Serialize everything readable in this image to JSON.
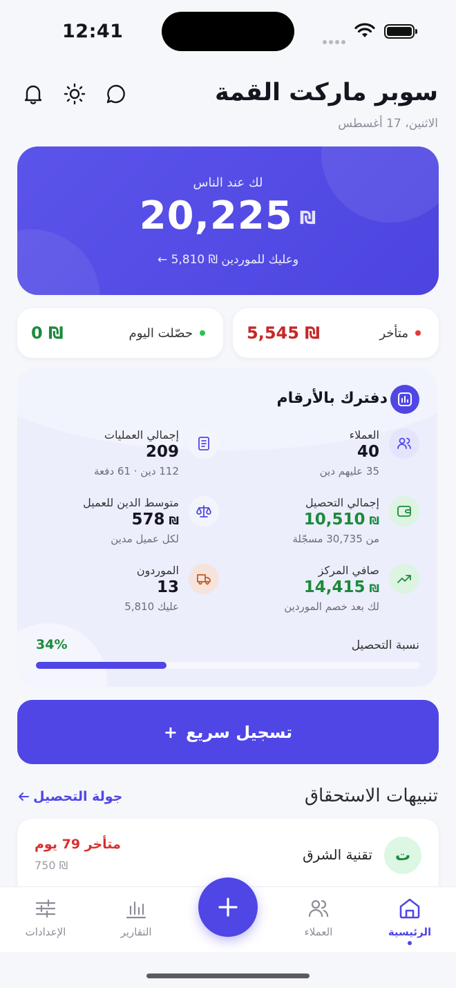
{
  "status": {
    "time": "12:41"
  },
  "header": {
    "title": "سوبر ماركت القمة",
    "date": "الاثنين، 17 أغسطس"
  },
  "hero": {
    "label": "لك عند الناس",
    "amount": "20,225",
    "currency": "₪",
    "suppliers_text": "وعليك للموردين ₪ 5,810 ←"
  },
  "stats": {
    "collected_today_label": "حصّلت اليوم",
    "collected_today_value": "0 ₪",
    "overdue_label": "متأخر",
    "overdue_value": "5,545 ₪"
  },
  "numbers": {
    "title": "دفترك بالأرقام",
    "metrics": [
      {
        "label": "العملاء",
        "value": "40",
        "sub": "35 عليهم دين"
      },
      {
        "label": "إجمالي العمليات",
        "value": "209",
        "sub": "112 دين · 61 دفعة"
      },
      {
        "label": "إجمالي التحصيل",
        "value": "10,510",
        "currency": "₪",
        "sub": "من 30,735 مسجّلة"
      },
      {
        "label": "متوسط الدين للعميل",
        "value": "578",
        "currency": "₪",
        "sub": "لكل عميل مدين"
      },
      {
        "label": "صافي المركز",
        "value": "14,415",
        "currency": "₪",
        "sub": "لك بعد خصم الموردين"
      },
      {
        "label": "الموردون",
        "value": "13",
        "sub": "عليك 5,810"
      }
    ],
    "rate_label": "نسبة التحصيل",
    "rate_value": "34%",
    "rate_fraction": 0.34
  },
  "quick_button": {
    "label": "تسجيل سريع",
    "icon": "+"
  },
  "alerts": {
    "title": "تنبيهات الاستحقاق",
    "link": "جولة التحصيل",
    "items": [
      {
        "initial": "ت",
        "name": "تقنية الشرق",
        "status": "متأخر 79 يوم",
        "amount": "750 ₪"
      }
    ]
  },
  "tabbar": {
    "home": "الرئيسية",
    "customers": "العملاء",
    "reports": "التقارير",
    "settings": "الإعدادات"
  },
  "colors": {
    "accent": "#4f46e5",
    "positive": "#1c8a3a",
    "negative": "#c62828"
  }
}
